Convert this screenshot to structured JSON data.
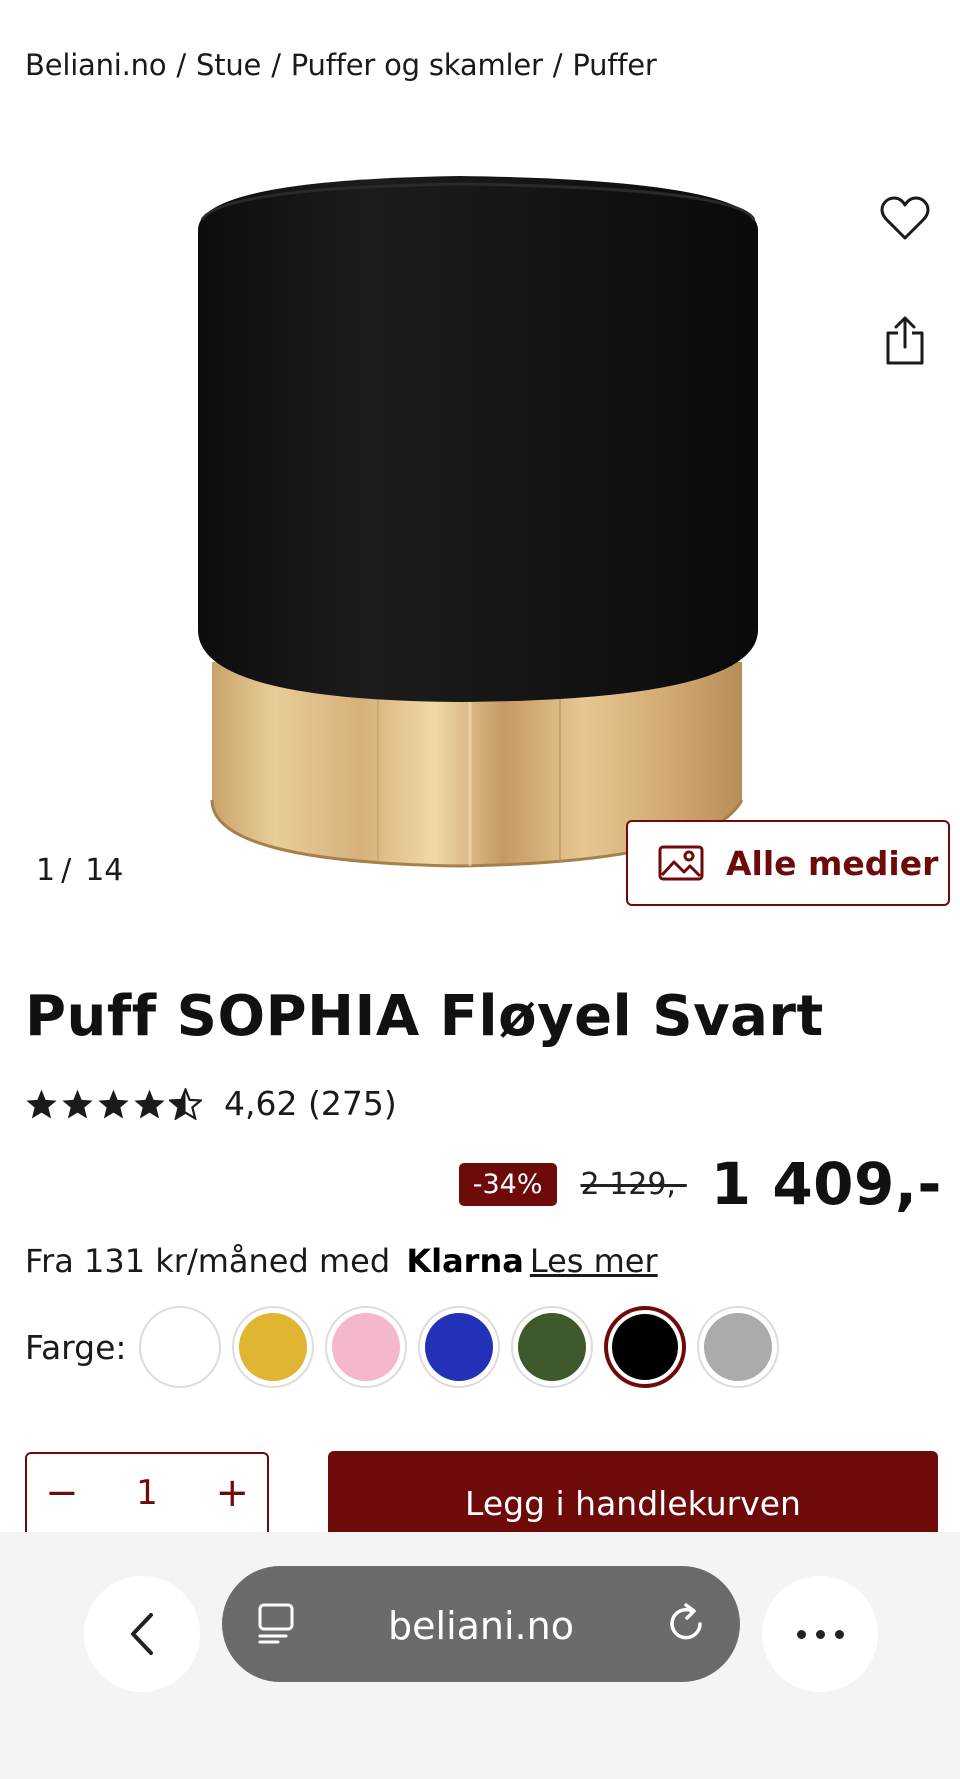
{
  "breadcrumb": {
    "items": [
      "Beliani.no",
      "Stue",
      "Puffer og skamler",
      "Puffer"
    ],
    "separator": "/"
  },
  "gallery": {
    "current": "1",
    "separator": "/",
    "total": "14",
    "media_button_label": "Alle medier",
    "favorite_icon": "heart-icon",
    "share_icon": "share-icon"
  },
  "product": {
    "title": "Puff SOPHIA Fløyel Svart",
    "rating": {
      "stars": 4.62,
      "text": "4,62 (275)"
    },
    "discount": "-34%",
    "old_price": "2 129,-",
    "price": "1 409,-",
    "klarna": {
      "prefix": "Fra 131 kr/måned med",
      "brand": "Klarna",
      "link": "Les mer"
    },
    "colors": {
      "label": "Farge:",
      "swatches": [
        {
          "name": "white",
          "hex": "#ffffff",
          "selected": false
        },
        {
          "name": "yellow",
          "hex": "#e0b531",
          "selected": false
        },
        {
          "name": "pink",
          "hex": "#f4b8c8",
          "selected": false
        },
        {
          "name": "blue",
          "hex": "#2330b8",
          "selected": false
        },
        {
          "name": "green",
          "hex": "#3e5a2c",
          "selected": false
        },
        {
          "name": "black",
          "hex": "#000000",
          "selected": true
        },
        {
          "name": "grey",
          "hex": "#ababab",
          "selected": false
        }
      ]
    },
    "quantity": {
      "minus": "−",
      "value": "1",
      "plus": "+"
    },
    "add_to_cart": "Legg i handlekurven"
  },
  "browser": {
    "url": "beliani.no",
    "back_icon": "chevron-left-icon",
    "tabs_icon": "tabs-icon",
    "reload_icon": "reload-icon",
    "more_icon": "more-icon"
  },
  "colors": {
    "accent": "#6e0a0a",
    "pill": "#6b6b6b"
  }
}
